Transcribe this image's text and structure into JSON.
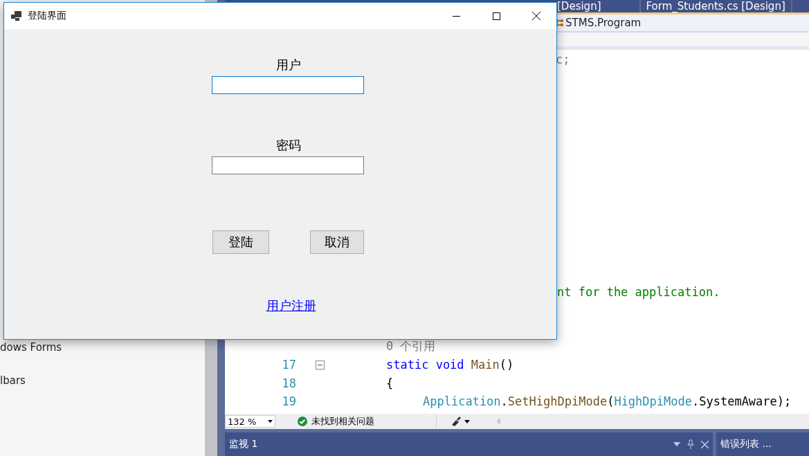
{
  "ide": {
    "tabs": [
      {
        "label": "[Design]",
        "selected": false
      },
      {
        "label": "Form_Students.cs [Design]",
        "selected": false
      }
    ],
    "nav": {
      "label": "STMS.Program"
    },
    "toolbox": [
      "dows Forms",
      "lbars"
    ],
    "editor": {
      "top_lines": [
        {
          "segments": [
            {
              "kind": "grey",
              "text": "c;"
            }
          ]
        }
      ],
      "bottom_lines": [
        {
          "segments": [
            {
              "kind": "comment",
              "text": "nt for the application."
            }
          ]
        },
        {
          "segments": [
            {
              "kind": "grey",
              "text": "0 个引用"
            }
          ]
        },
        {
          "number": "17",
          "collapse": true,
          "segments": [
            {
              "kind": "keyword",
              "text": "static void "
            },
            {
              "kind": "method",
              "text": "Main"
            },
            {
              "kind": "plain",
              "text": "()"
            }
          ]
        },
        {
          "number": "18",
          "segments": [
            {
              "kind": "plain",
              "text": "{"
            }
          ]
        },
        {
          "number": "19",
          "indented": true,
          "segments": [
            {
              "kind": "type",
              "text": "Application"
            },
            {
              "kind": "plain",
              "text": "."
            },
            {
              "kind": "method",
              "text": "SetHighDpiMode"
            },
            {
              "kind": "plain",
              "text": "("
            },
            {
              "kind": "type",
              "text": "HighDpiMode"
            },
            {
              "kind": "plain",
              "text": ".SystemAware);"
            }
          ]
        }
      ]
    },
    "status": {
      "zoom": "132 %",
      "issues": "未找到相关问题"
    },
    "panels": [
      {
        "title": "监视 1"
      },
      {
        "title": "错误列表 ..."
      }
    ]
  },
  "dialog": {
    "title": "登陆界面",
    "fields": [
      {
        "label": "用户",
        "focused": true
      },
      {
        "label": "密码",
        "focused": false
      }
    ],
    "buttons": [
      "登陆",
      "取消"
    ],
    "link": "用户注册"
  }
}
